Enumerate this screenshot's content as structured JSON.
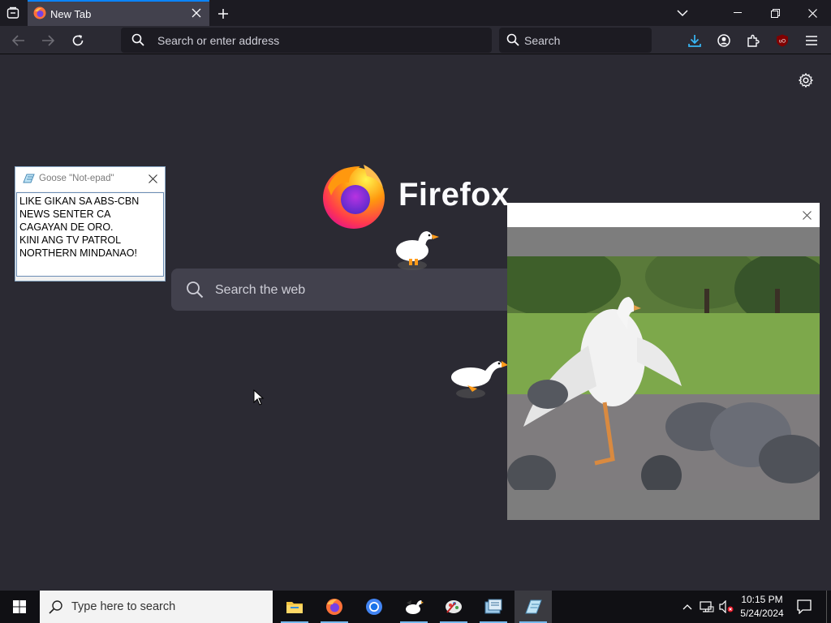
{
  "browser": {
    "tab_title": "New Tab",
    "url_placeholder": "Search or enter address",
    "search_placeholder": "Search",
    "wordmark": "Firefox",
    "page_search_placeholder": "Search the web"
  },
  "notepad": {
    "title": "Goose \"Not-epad\"",
    "text": "LIKE GIKAN SA ABS-CBN\nNEWS SENTER CA\nCAGAYAN DE ORO.\nKINI ANG TV PATROL\nNORTHERN MINDANAO!"
  },
  "taskbar": {
    "search_placeholder": "Type here to search",
    "time": "10:15 PM",
    "date": "5/24/2024"
  },
  "colors": {
    "accent": "#0a84ff",
    "taskbar_underline": "#76b9ed"
  }
}
